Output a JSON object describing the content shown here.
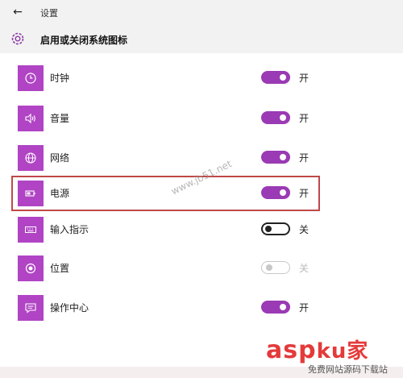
{
  "window": {
    "title": "设置"
  },
  "page": {
    "title": "启用或关闭系统图标"
  },
  "colors": {
    "accent": "#b044c4",
    "toggle_on": "#9a3ab4",
    "highlight": "#c04848"
  },
  "items": [
    {
      "label": "时钟",
      "icon": "clock-icon",
      "state": "开",
      "toggle": "on"
    },
    {
      "label": "音量",
      "icon": "volume-icon",
      "state": "开",
      "toggle": "on"
    },
    {
      "label": "网络",
      "icon": "network-icon",
      "state": "开",
      "toggle": "on"
    },
    {
      "label": "电源",
      "icon": "battery-icon",
      "state": "开",
      "toggle": "on"
    },
    {
      "label": "输入指示",
      "icon": "keyboard-icon",
      "state": "关",
      "toggle": "off"
    },
    {
      "label": "位置",
      "icon": "location-icon",
      "state": "关",
      "toggle": "disabled"
    },
    {
      "label": "操作中心",
      "icon": "action-center-icon",
      "state": "开",
      "toggle": "on"
    }
  ],
  "watermark": {
    "site": "www.jb51.net",
    "brand": "asp",
    "brand_cn": "ku家",
    "brand_sub": "免费网站源码下载站"
  }
}
